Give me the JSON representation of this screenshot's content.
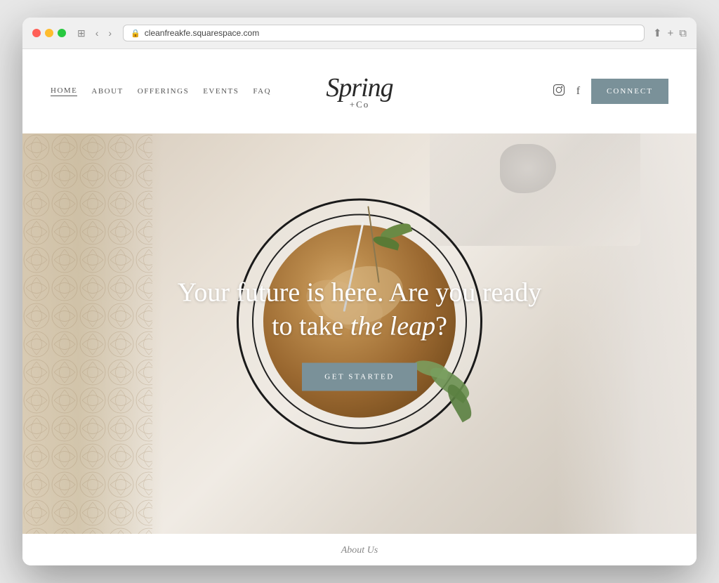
{
  "browser": {
    "url": "cleanfreakfe.squarespace.com",
    "controls": {
      "back": "‹",
      "forward": "›"
    }
  },
  "nav": {
    "links": [
      {
        "label": "HOME",
        "active": true
      },
      {
        "label": "ABOUT",
        "active": false
      },
      {
        "label": "OFFERINGS",
        "active": false
      },
      {
        "label": "EVENTS",
        "active": false
      },
      {
        "label": "FAQ",
        "active": false
      }
    ],
    "logo_line1": "Spring",
    "logo_symbol": "+",
    "logo_line2": "Co",
    "connect_label": "CONNeCT",
    "instagram_icon": "⬡",
    "facebook_icon": "f"
  },
  "hero": {
    "headline_line1": "Your future is here. Are you ready",
    "headline_line2": "to take ",
    "headline_italic": "the leap",
    "headline_end": "?",
    "cta_label": "GET STARTED"
  },
  "about_teaser": {
    "label": "About Us"
  },
  "colors": {
    "accent": "#7a9199",
    "text_dark": "#2a2a2a",
    "text_mid": "#555555",
    "nav_bg": "#ffffff"
  }
}
